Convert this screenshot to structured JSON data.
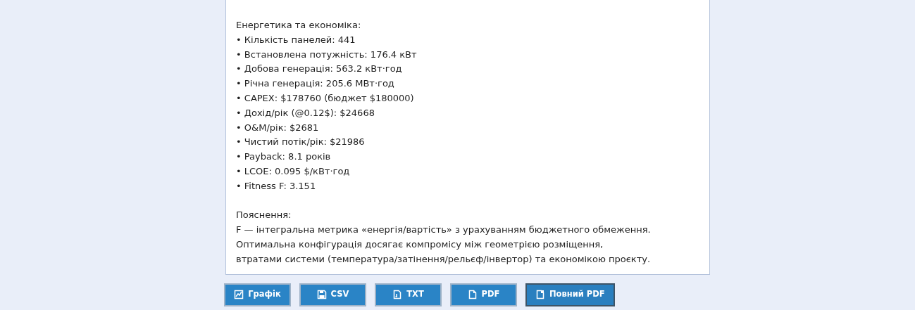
{
  "report": {
    "sections": [
      {
        "heading": "Енергетика та економіка:",
        "lines": [
          "• Кількість панелей: 441",
          "• Встановлена потужність: 176.4 кВт",
          "• Добова генерація: 563.2 кВт·год",
          "• Річна генерація: 205.6 МВт·год",
          "• CAPEX: $178760 (бюджет $180000)",
          "• Дохід/рік (@0.12$): $24668",
          "• O&M/рік: $2681",
          "• Чистий потік/рік: $21986",
          "• Payback: 8.1 років",
          "• LCOE: 0.095 $/кВт·год",
          "• Fitness F: 3.151"
        ]
      },
      {
        "heading": "Пояснення:",
        "lines": [
          "F — інтегральна метрика «енергія/вартість» з урахуванням бюджетного обмеження.",
          "Оптимальна конфігурація досягає компромісу між геометрією розміщення,",
          "втратами системи (температура/затінення/рельєф/інвертор) та економікою проєкту."
        ]
      }
    ]
  },
  "buttons": [
    {
      "label": "Графік",
      "kind": "chart",
      "focused": false
    },
    {
      "label": "CSV",
      "kind": "save",
      "focused": false
    },
    {
      "label": "TXT",
      "kind": "text",
      "focused": false
    },
    {
      "label": "PDF",
      "kind": "doc",
      "focused": false
    },
    {
      "label": "Повний PDF",
      "kind": "docs",
      "focused": true
    }
  ]
}
